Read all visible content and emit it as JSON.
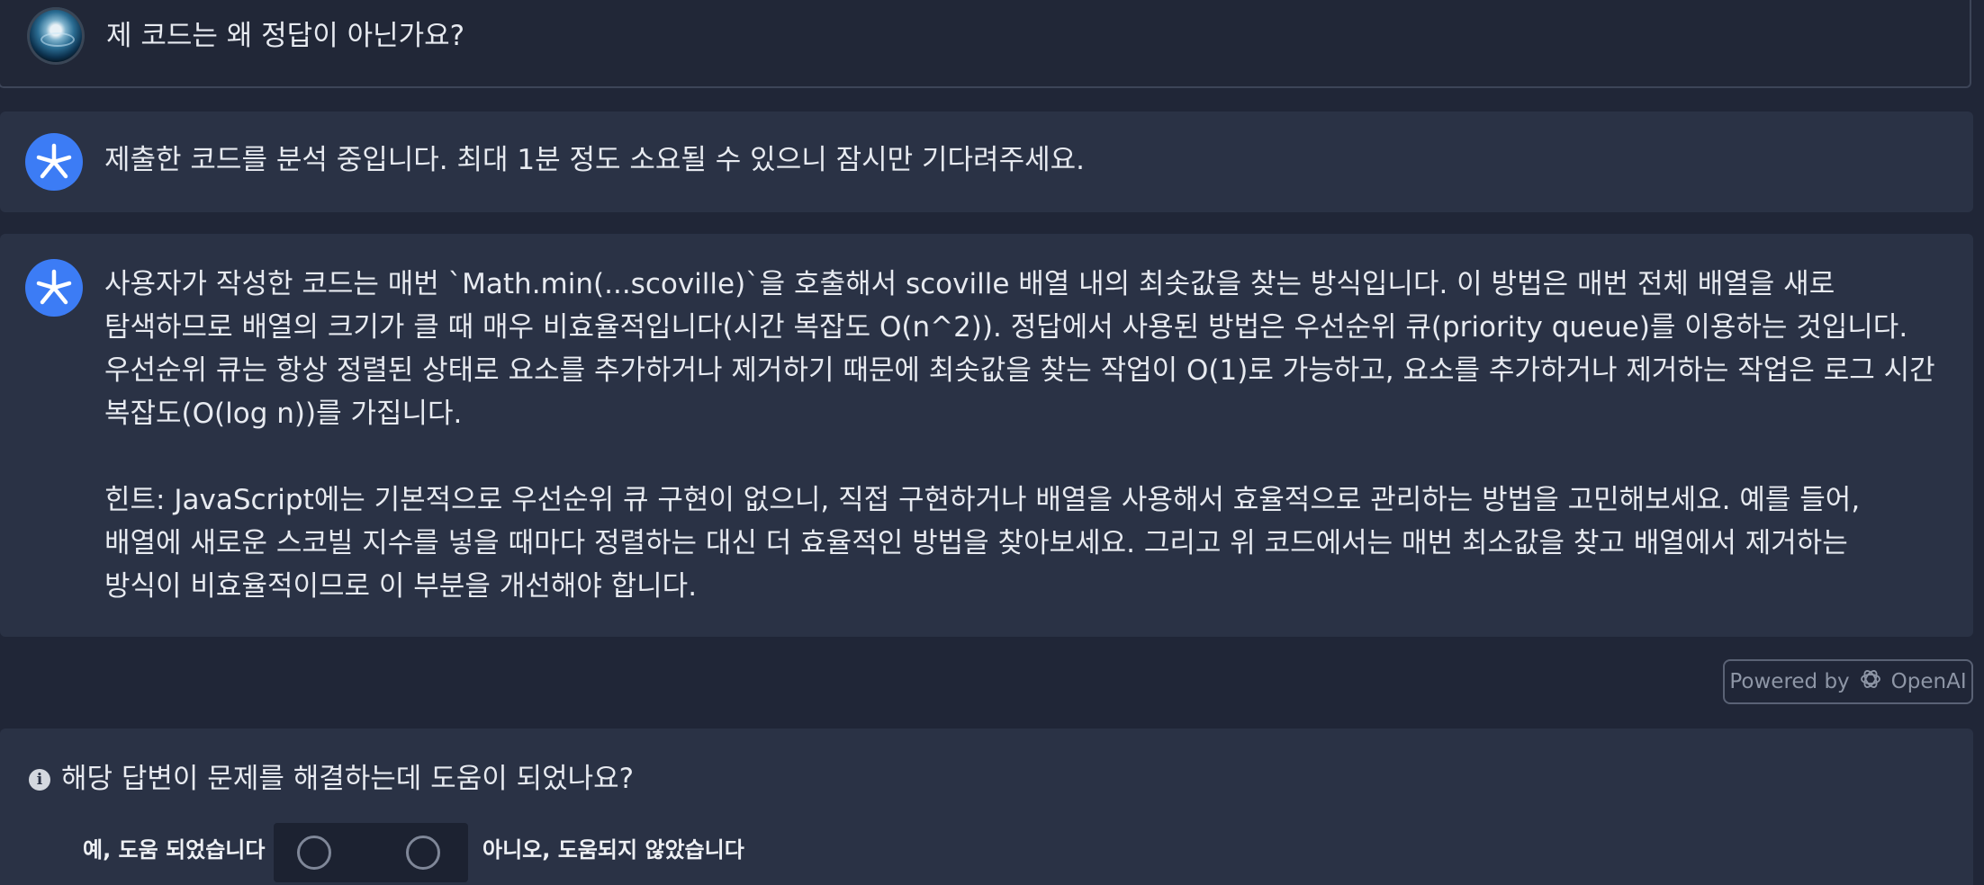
{
  "user_message": {
    "text": "제 코드는 왜 정답이 아닌가요?",
    "avatar_icon": "user-avatar"
  },
  "status_message": {
    "icon": "assistant-logo-icon",
    "text": "제출한 코드를 분석 중입니다. 최대 1분 정도 소요될 수 있으니 잠시만 기다려주세요."
  },
  "answer": {
    "icon": "assistant-logo-icon",
    "paragraph1": [
      "사용자가 작성한 코드는 매번 `Math.min(...scoville)`을 호출해서 scoville 배열 내의 최솟값을 찾는 방식입니다. 이 방법은 매번 전체 배열을 새로",
      "탐색하므로 배열의 크기가 클 때 매우 비효율적입니다(시간 복잡도 O(n^2)). 정답에서 사용된 방법은 우선순위 큐(priority queue)를 이용하는 것입니다.",
      "우선순위 큐는 항상 정렬된 상태로 요소를 추가하거나 제거하기 때문에 최솟값을 찾는 작업이 O(1)로 가능하고, 요소를 추가하거나 제거하는 작업은 로그 시간",
      "복잡도(O(log n))를 가집니다."
    ],
    "paragraph2": [
      "힌트: JavaScript에는 기본적으로 우선순위 큐 구현이 없으니, 직접 구현하거나 배열을 사용해서 효율적으로 관리하는 방법을 고민해보세요. 예를 들어,",
      "배열에 새로운 스코빌 지수를 넣을 때마다 정렬하는 대신 더 효율적인 방법을 찾아보세요. 그리고 위 코드에서는 매번 최소값을 찾고 배열에서 제거하는",
      "방식이 비효율적이므로 이 부분을 개선해야 합니다."
    ]
  },
  "powered_by": {
    "prefix": "Powered by",
    "brand": "OpenAI",
    "icon": "openai-logo-icon"
  },
  "feedback": {
    "question": "해당 답변이 문제를 해결하는데 도움이 되었나요?",
    "info_icon": "info-icon",
    "yes_label": "예, 도움 되었습니다",
    "no_label": "아니오, 도움되지 않았습니다",
    "selected": null
  },
  "colors": {
    "page_bg": "#202637",
    "card_bg": "#2a3245",
    "accent_blue": "#3c7cf5",
    "text": "#e7eaf0",
    "muted": "#8e96a6"
  }
}
